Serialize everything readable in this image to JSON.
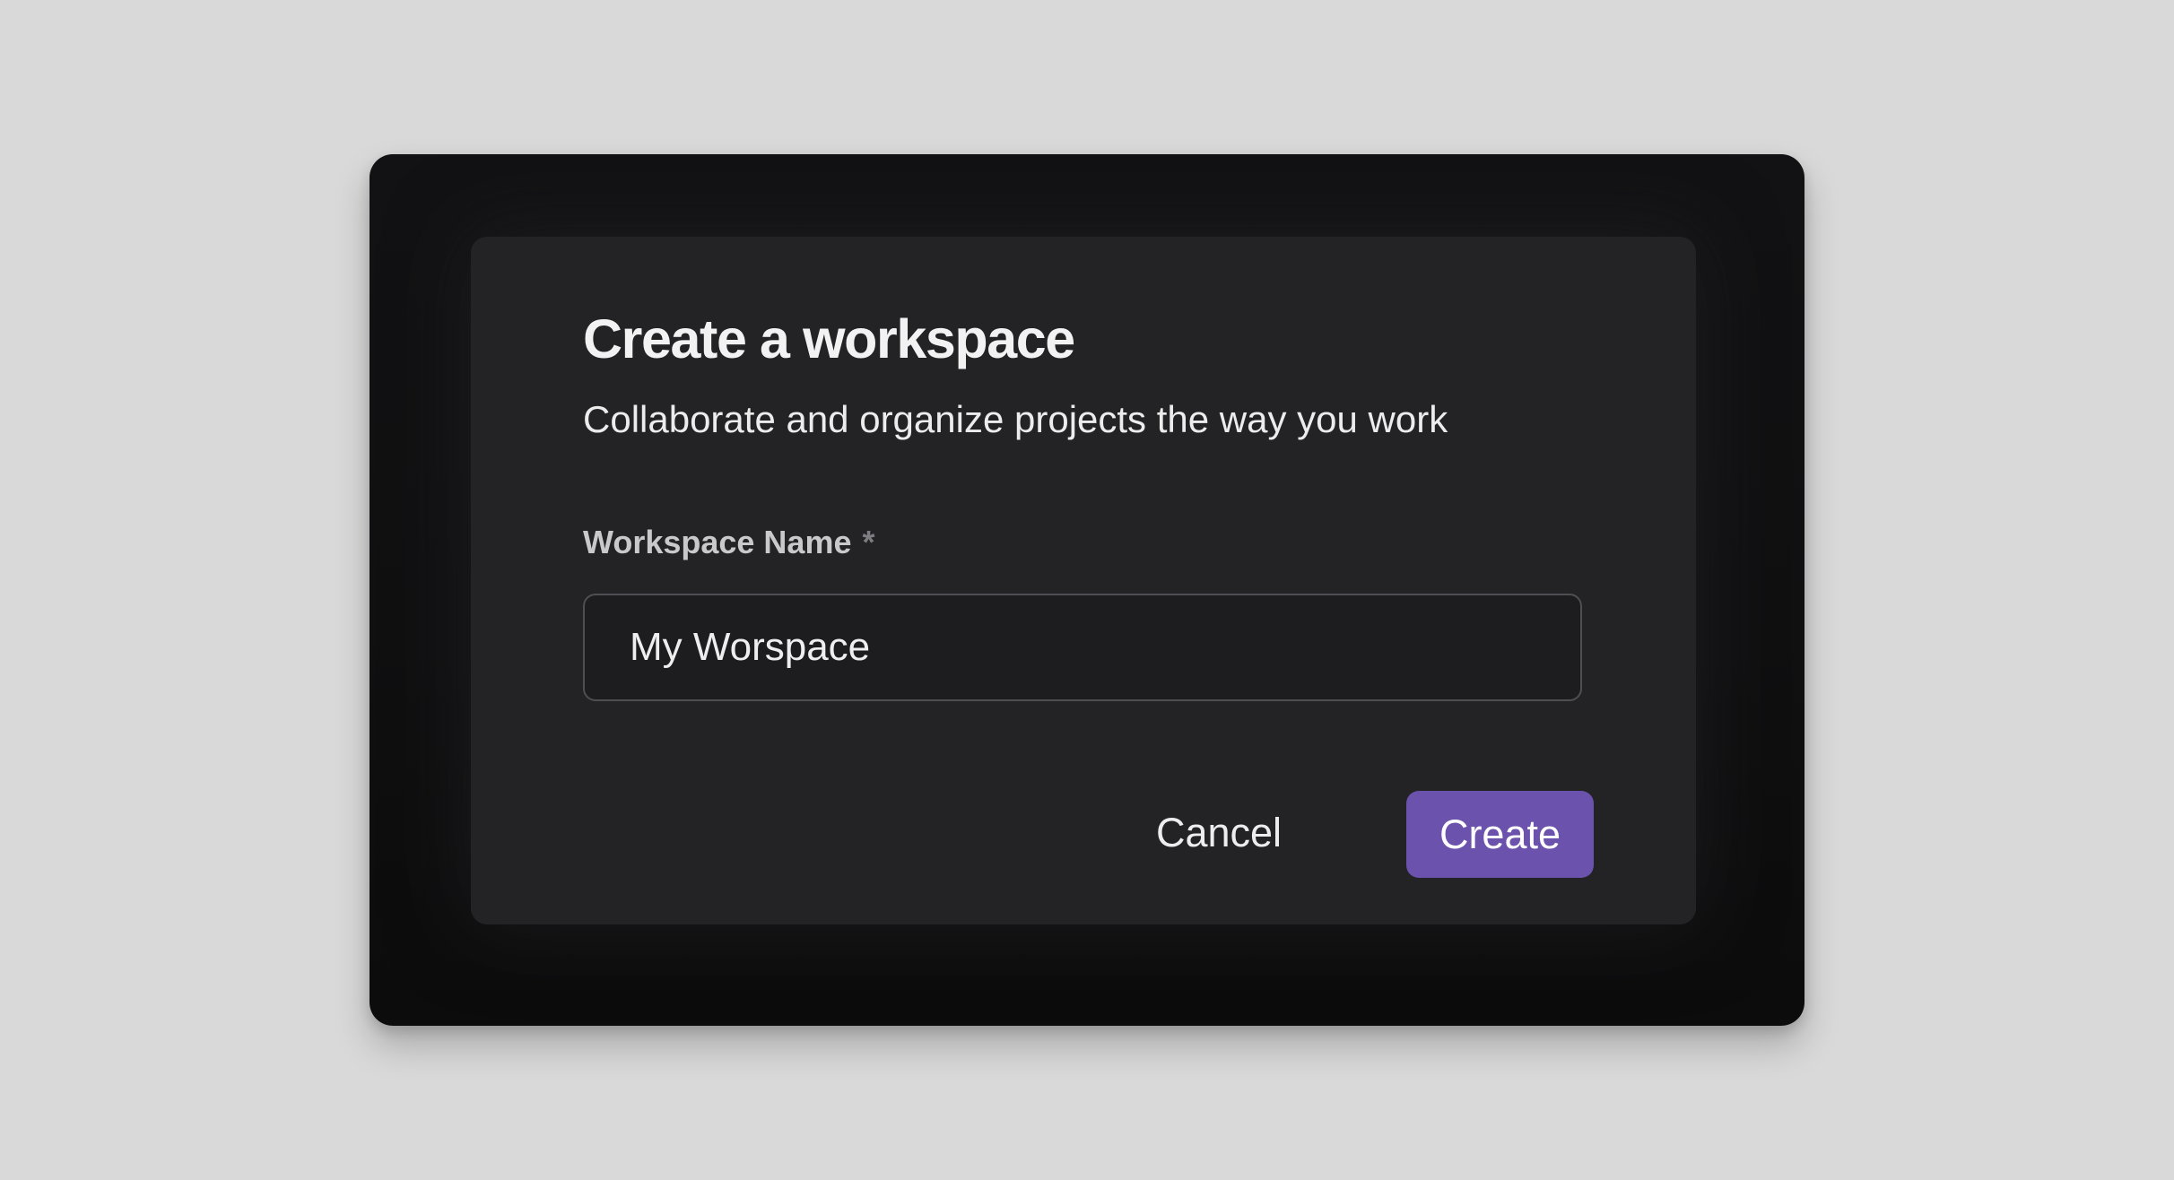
{
  "dialog": {
    "title": "Create a workspace",
    "subtitle": "Collaborate and organize projects the way you work",
    "field_label": "Workspace Name",
    "required_marker": "*",
    "input_value": "My Worspace",
    "cancel_label": "Cancel",
    "create_label": "Create"
  },
  "colors": {
    "page_background": "#d9d9d9",
    "window_background": "#111113",
    "dialog_background": "#232326",
    "input_border": "#4e4e53",
    "accent": "#6b52ad",
    "text_primary": "#f2f2f2",
    "text_label": "#c9c9cc"
  }
}
